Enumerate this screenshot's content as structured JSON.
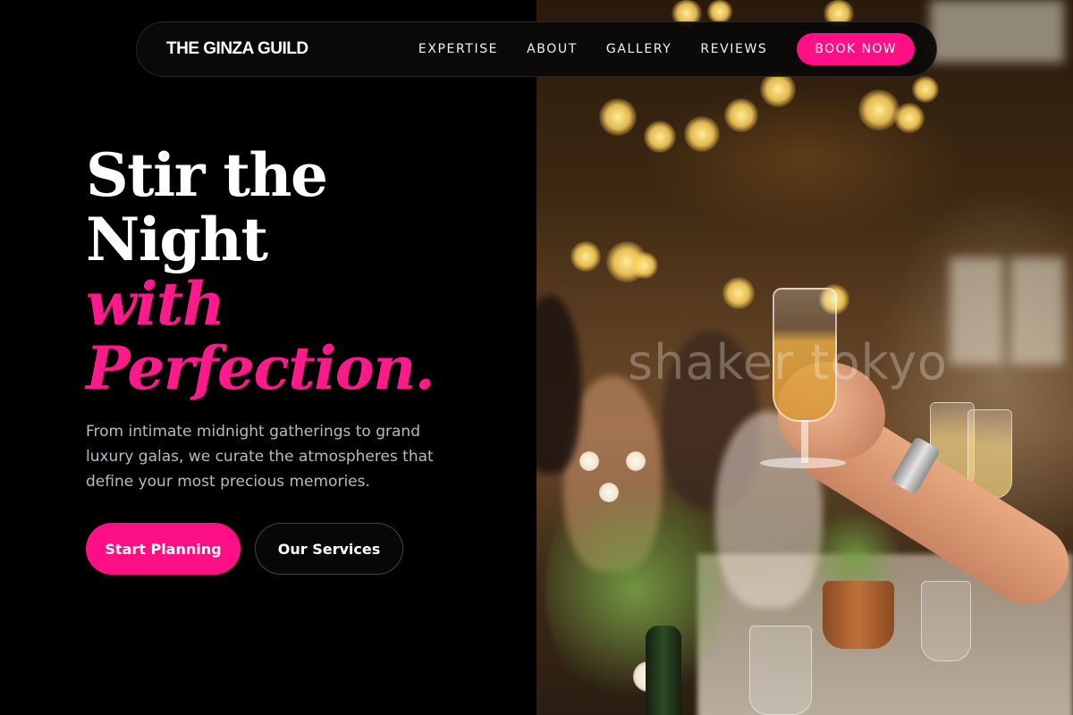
{
  "header": {
    "brand": "THE GINZA GUILD",
    "nav": [
      {
        "label": "EXPERTISE"
      },
      {
        "label": "ABOUT"
      },
      {
        "label": "GALLERY"
      },
      {
        "label": "REVIEWS"
      }
    ],
    "book_label": "BOOK NOW"
  },
  "hero": {
    "headline_lines": [
      "Stir the",
      "Night"
    ],
    "accent_lines": [
      "with",
      "Perfection."
    ],
    "subtitle": "From intimate midnight gatherings to grand luxury galas, we curate the atmospheres that define your most precious memories.",
    "primary_cta": "Start Planning",
    "secondary_cta": "Our Services"
  },
  "photo": {
    "watermark": "shaker tokyo",
    "alt_subject": "champagne-toast-at-banquet"
  },
  "colors": {
    "accent": "#ff0f86",
    "background": "#000000",
    "text": "#ffffff",
    "muted_text": "#b9b9c0"
  }
}
